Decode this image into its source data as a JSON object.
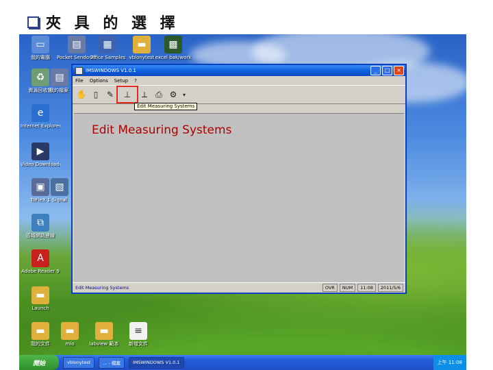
{
  "slide": {
    "title": "夾 具 的 選 擇"
  },
  "desktop": {
    "icons": [
      {
        "label": "我的電腦"
      },
      {
        "label": "資源回收筒"
      },
      {
        "label": "Internet Explorer"
      },
      {
        "label": "Video Downloader"
      },
      {
        "label": "ToFleX 1"
      },
      {
        "label": "區域網路連線"
      },
      {
        "label": "Adobe Reader 9"
      },
      {
        "label": "Launch"
      },
      {
        "label": "我的文件"
      },
      {
        "label": "Pocket Sendo Remot"
      },
      {
        "label": "Office Samples"
      },
      {
        "label": "vblonytest"
      },
      {
        "label": "excel bak/work"
      },
      {
        "label": "我的檔案 s"
      },
      {
        "label": "Signal"
      },
      {
        "label": "mio"
      },
      {
        "label": "labview 範本"
      },
      {
        "label": "新增文件"
      }
    ]
  },
  "window": {
    "title": "IMSWINDOWS V1.0.1",
    "menu": [
      "File",
      "Options",
      "Setup",
      "?"
    ],
    "tooltip": "Edit Measuring Systems",
    "main_text": "Edit Measuring Systems",
    "status": {
      "message": "Edit Measuring Systems",
      "caps": "OVR",
      "num": "NUM",
      "time": "11:08",
      "date": "2011/5/6"
    }
  },
  "taskbar": {
    "start_label": "開始",
    "tasks": [
      "vblonytest",
      "... - 檔案",
      "IMSWINDOWS V1.0.1"
    ],
    "clock": "上午 11:08"
  },
  "colors": {
    "accent": "#0a3fc2",
    "highlight": "#e0281e",
    "label_text": "#b00000"
  }
}
